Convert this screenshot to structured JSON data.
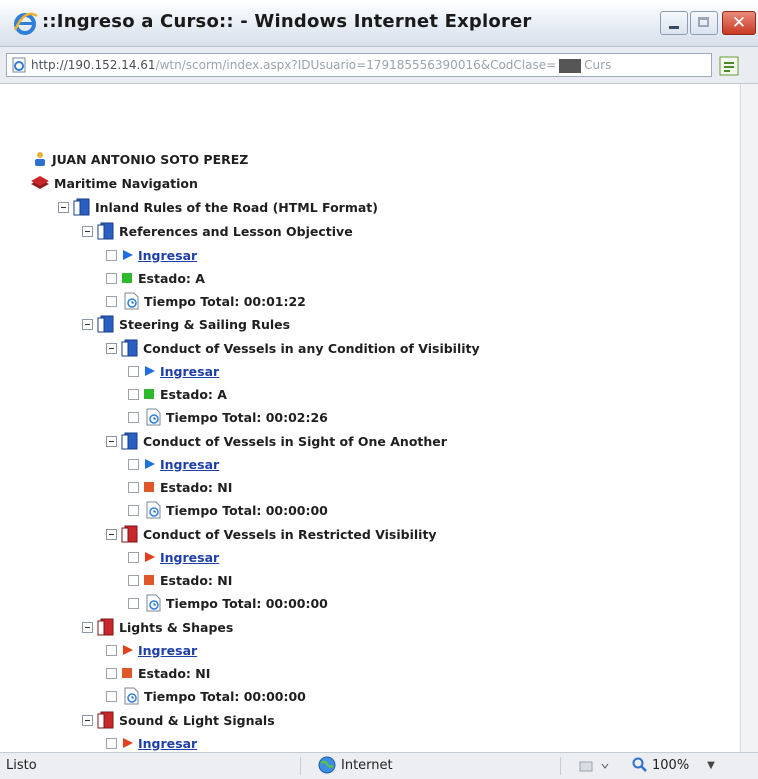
{
  "window": {
    "title": "::Ingreso a Curso:: - Windows Internet Explorer",
    "minimize_glyph": "",
    "close_glyph": "✕"
  },
  "address": {
    "url_host": "http://190.152.14.61",
    "url_path": "/wtn/scorm/index.aspx?IDUsuario=179185556390016&CodClase=",
    "url_tail": "Curs"
  },
  "tree": {
    "user_name": "JUAN ANTONIO SOTO PEREZ",
    "course": "Maritime Navigation",
    "module": "Inland Rules of the Road (HTML Format)",
    "lessons": [
      {
        "title": "References and Lesson Objective",
        "enter": "Ingresar",
        "state": "Estado: A",
        "time": "Tiempo Total: 00:01:22",
        "status_color": "#2db82d"
      },
      {
        "title": "Steering & Sailing Rules",
        "children": [
          {
            "title": "Conduct of Vessels in any Condition of Visibility",
            "enter": "Ingresar",
            "state": "Estado: A",
            "time": "Tiempo Total: 00:02:26",
            "status_color": "#2db82d"
          },
          {
            "title": "Conduct of Vessels in Sight of One Another",
            "enter": "Ingresar",
            "state": "Estado: NI",
            "time": "Tiempo Total: 00:00:00",
            "status_color": "#e0582a"
          },
          {
            "title": "Conduct of Vessels in Restricted Visibility",
            "enter": "Ingresar",
            "state": "Estado: NI",
            "time": "Tiempo Total: 00:00:00",
            "status_color": "#e0582a"
          }
        ]
      },
      {
        "title": "Lights & Shapes",
        "enter": "Ingresar",
        "state": "Estado: NI",
        "time": "Tiempo Total: 00:00:00",
        "status_color": "#e0582a"
      },
      {
        "title": "Sound & Light Signals",
        "enter": "Ingresar"
      }
    ]
  },
  "status": {
    "left": "Listo",
    "zone": "Internet",
    "zoom": "100%"
  },
  "colors": {
    "book_blue": "#2a5fc4",
    "book_red": "#c8262a",
    "play_blue": "#1f6fe0",
    "play_red": "#e0401a",
    "link": "#1f3fa8"
  }
}
